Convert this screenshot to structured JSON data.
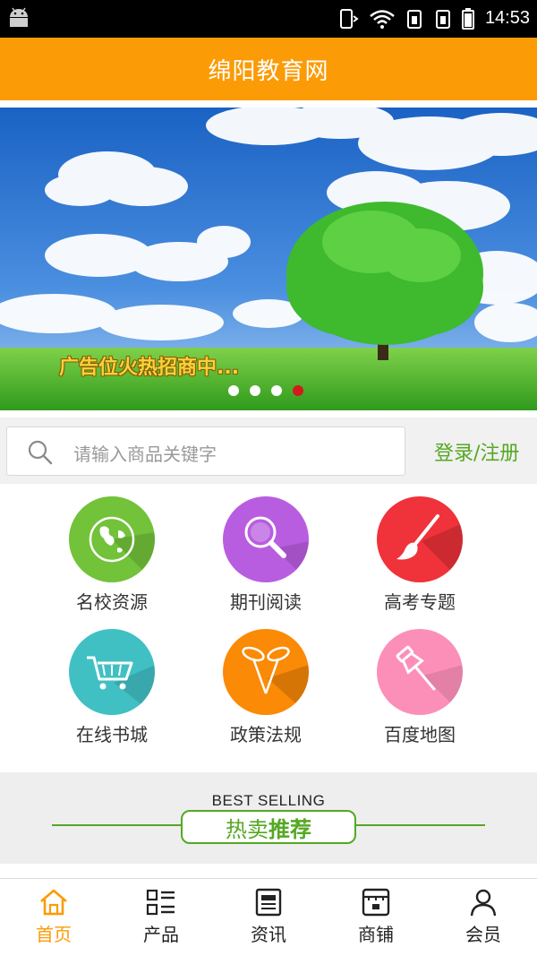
{
  "status_bar": {
    "time": "14:53"
  },
  "header": {
    "title": "绵阳教育网"
  },
  "banner": {
    "ad_text": "广告位火热招商中...",
    "dot_count": 4,
    "active_dot": 4
  },
  "search": {
    "placeholder": "请输入商品关键字",
    "login_label": "登录/注册"
  },
  "grid": [
    {
      "label": "名校资源",
      "color": "#72c23a",
      "icon": "globe-icon"
    },
    {
      "label": "期刊阅读",
      "color": "#b95de0",
      "icon": "magnifier-icon"
    },
    {
      "label": "高考专题",
      "color": "#f0323a",
      "icon": "paintbrush-icon"
    },
    {
      "label": "在线书城",
      "color": "#41c0c4",
      "icon": "shopping-cart-icon"
    },
    {
      "label": "政策法规",
      "color": "#fb8a06",
      "icon": "pushpins-icon"
    },
    {
      "label": "百度地图",
      "color": "#fc8fb8",
      "icon": "map-pin-icon"
    }
  ],
  "section": {
    "subtitle_en": "BEST SELLING",
    "title_part1": "热卖",
    "title_part2": "推荐"
  },
  "bottom_nav": [
    {
      "label": "首页",
      "icon": "home-icon",
      "active": true
    },
    {
      "label": "产品",
      "icon": "list-grid-icon",
      "active": false
    },
    {
      "label": "资讯",
      "icon": "news-icon",
      "active": false
    },
    {
      "label": "商铺",
      "icon": "store-icon",
      "active": false
    },
    {
      "label": "会员",
      "icon": "user-icon",
      "active": false
    }
  ],
  "colors": {
    "accent": "#fb9b06",
    "green": "#55a823",
    "active_dot": "#d21b1b"
  }
}
